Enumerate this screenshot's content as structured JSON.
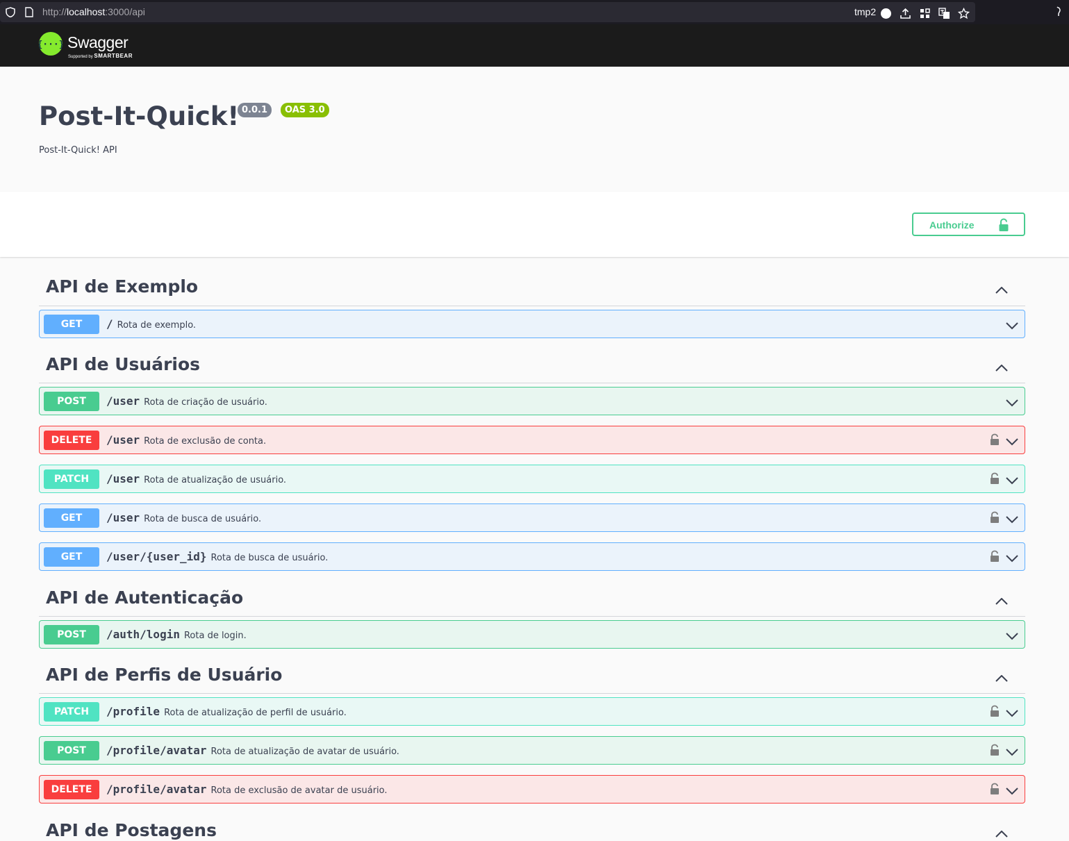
{
  "browser": {
    "url_prefix": "http://",
    "url_host": "localhost",
    "url_rest": ":3000/api",
    "profile_tag": "tmp2"
  },
  "topbar": {
    "logo_text": "Swagger",
    "logo_sub_prefix": "Supported by",
    "logo_sub_brand": "SMARTBEAR"
  },
  "info": {
    "title": "Post-It-Quick!",
    "version": "0.0.1",
    "oas": "OAS 3.0",
    "description": "Post-It-Quick! API"
  },
  "authorize_label": "Authorize",
  "sections": [
    {
      "title": "API de Exemplo",
      "ops": [
        {
          "method": "GET",
          "path": "/",
          "summary": "Rota de exemplo.",
          "locked": false
        }
      ]
    },
    {
      "title": "API de Usuários",
      "ops": [
        {
          "method": "POST",
          "path": "/user",
          "summary": "Rota de criação de usuário.",
          "locked": false
        },
        {
          "method": "DELETE",
          "path": "/user",
          "summary": "Rota de exclusão de conta.",
          "locked": true
        },
        {
          "method": "PATCH",
          "path": "/user",
          "summary": "Rota de atualização de usuário.",
          "locked": true
        },
        {
          "method": "GET",
          "path": "/user",
          "summary": "Rota de busca de usuário.",
          "locked": true
        },
        {
          "method": "GET",
          "path": "/user/{user_id}",
          "summary": "Rota de busca de usuário.",
          "locked": true
        }
      ]
    },
    {
      "title": "API de Autenticação",
      "ops": [
        {
          "method": "POST",
          "path": "/auth/login",
          "summary": "Rota de login.",
          "locked": false
        }
      ]
    },
    {
      "title": "API de Perfis de Usuário",
      "ops": [
        {
          "method": "PATCH",
          "path": "/profile",
          "summary": "Rota de atualização de perfil de usuário.",
          "locked": true
        },
        {
          "method": "POST",
          "path": "/profile/avatar",
          "summary": "Rota de atualização de avatar de usuário.",
          "locked": true
        },
        {
          "method": "DELETE",
          "path": "/profile/avatar",
          "summary": "Rota de exclusão de avatar de usuário.",
          "locked": true
        }
      ]
    },
    {
      "title": "API de Postagens",
      "ops": []
    }
  ],
  "colors": {
    "get": "#61affe",
    "post": "#49cc90",
    "delete": "#f93e3e",
    "patch": "#50e3c2",
    "swagger_green": "#85ea2d"
  }
}
